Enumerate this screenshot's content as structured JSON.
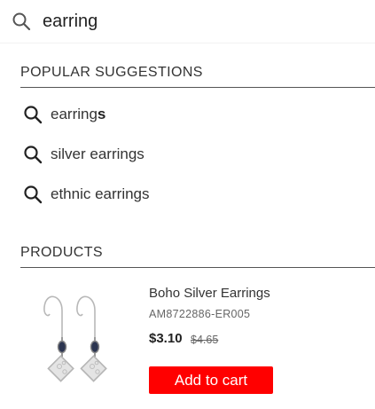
{
  "search": {
    "value": "earring",
    "icon": "search-icon"
  },
  "suggestions": {
    "heading": "POPULAR SUGGESTIONS",
    "items": [
      {
        "prefix": "earring",
        "bold": "s",
        "icon": "search-icon"
      },
      {
        "prefix": "silver earrings",
        "bold": "",
        "icon": "search-icon"
      },
      {
        "prefix": "ethnic earrings",
        "bold": "",
        "icon": "search-icon"
      }
    ]
  },
  "products": {
    "heading": "PRODUCTS",
    "items": [
      {
        "name": "Boho Silver Earrings",
        "sku": "AM8722886-ER005",
        "price": "$3.10",
        "old_price": "$4.65",
        "button_label": "Add to cart"
      }
    ]
  },
  "colors": {
    "accent": "#ff0000",
    "text": "#222222",
    "muted": "#666666"
  }
}
